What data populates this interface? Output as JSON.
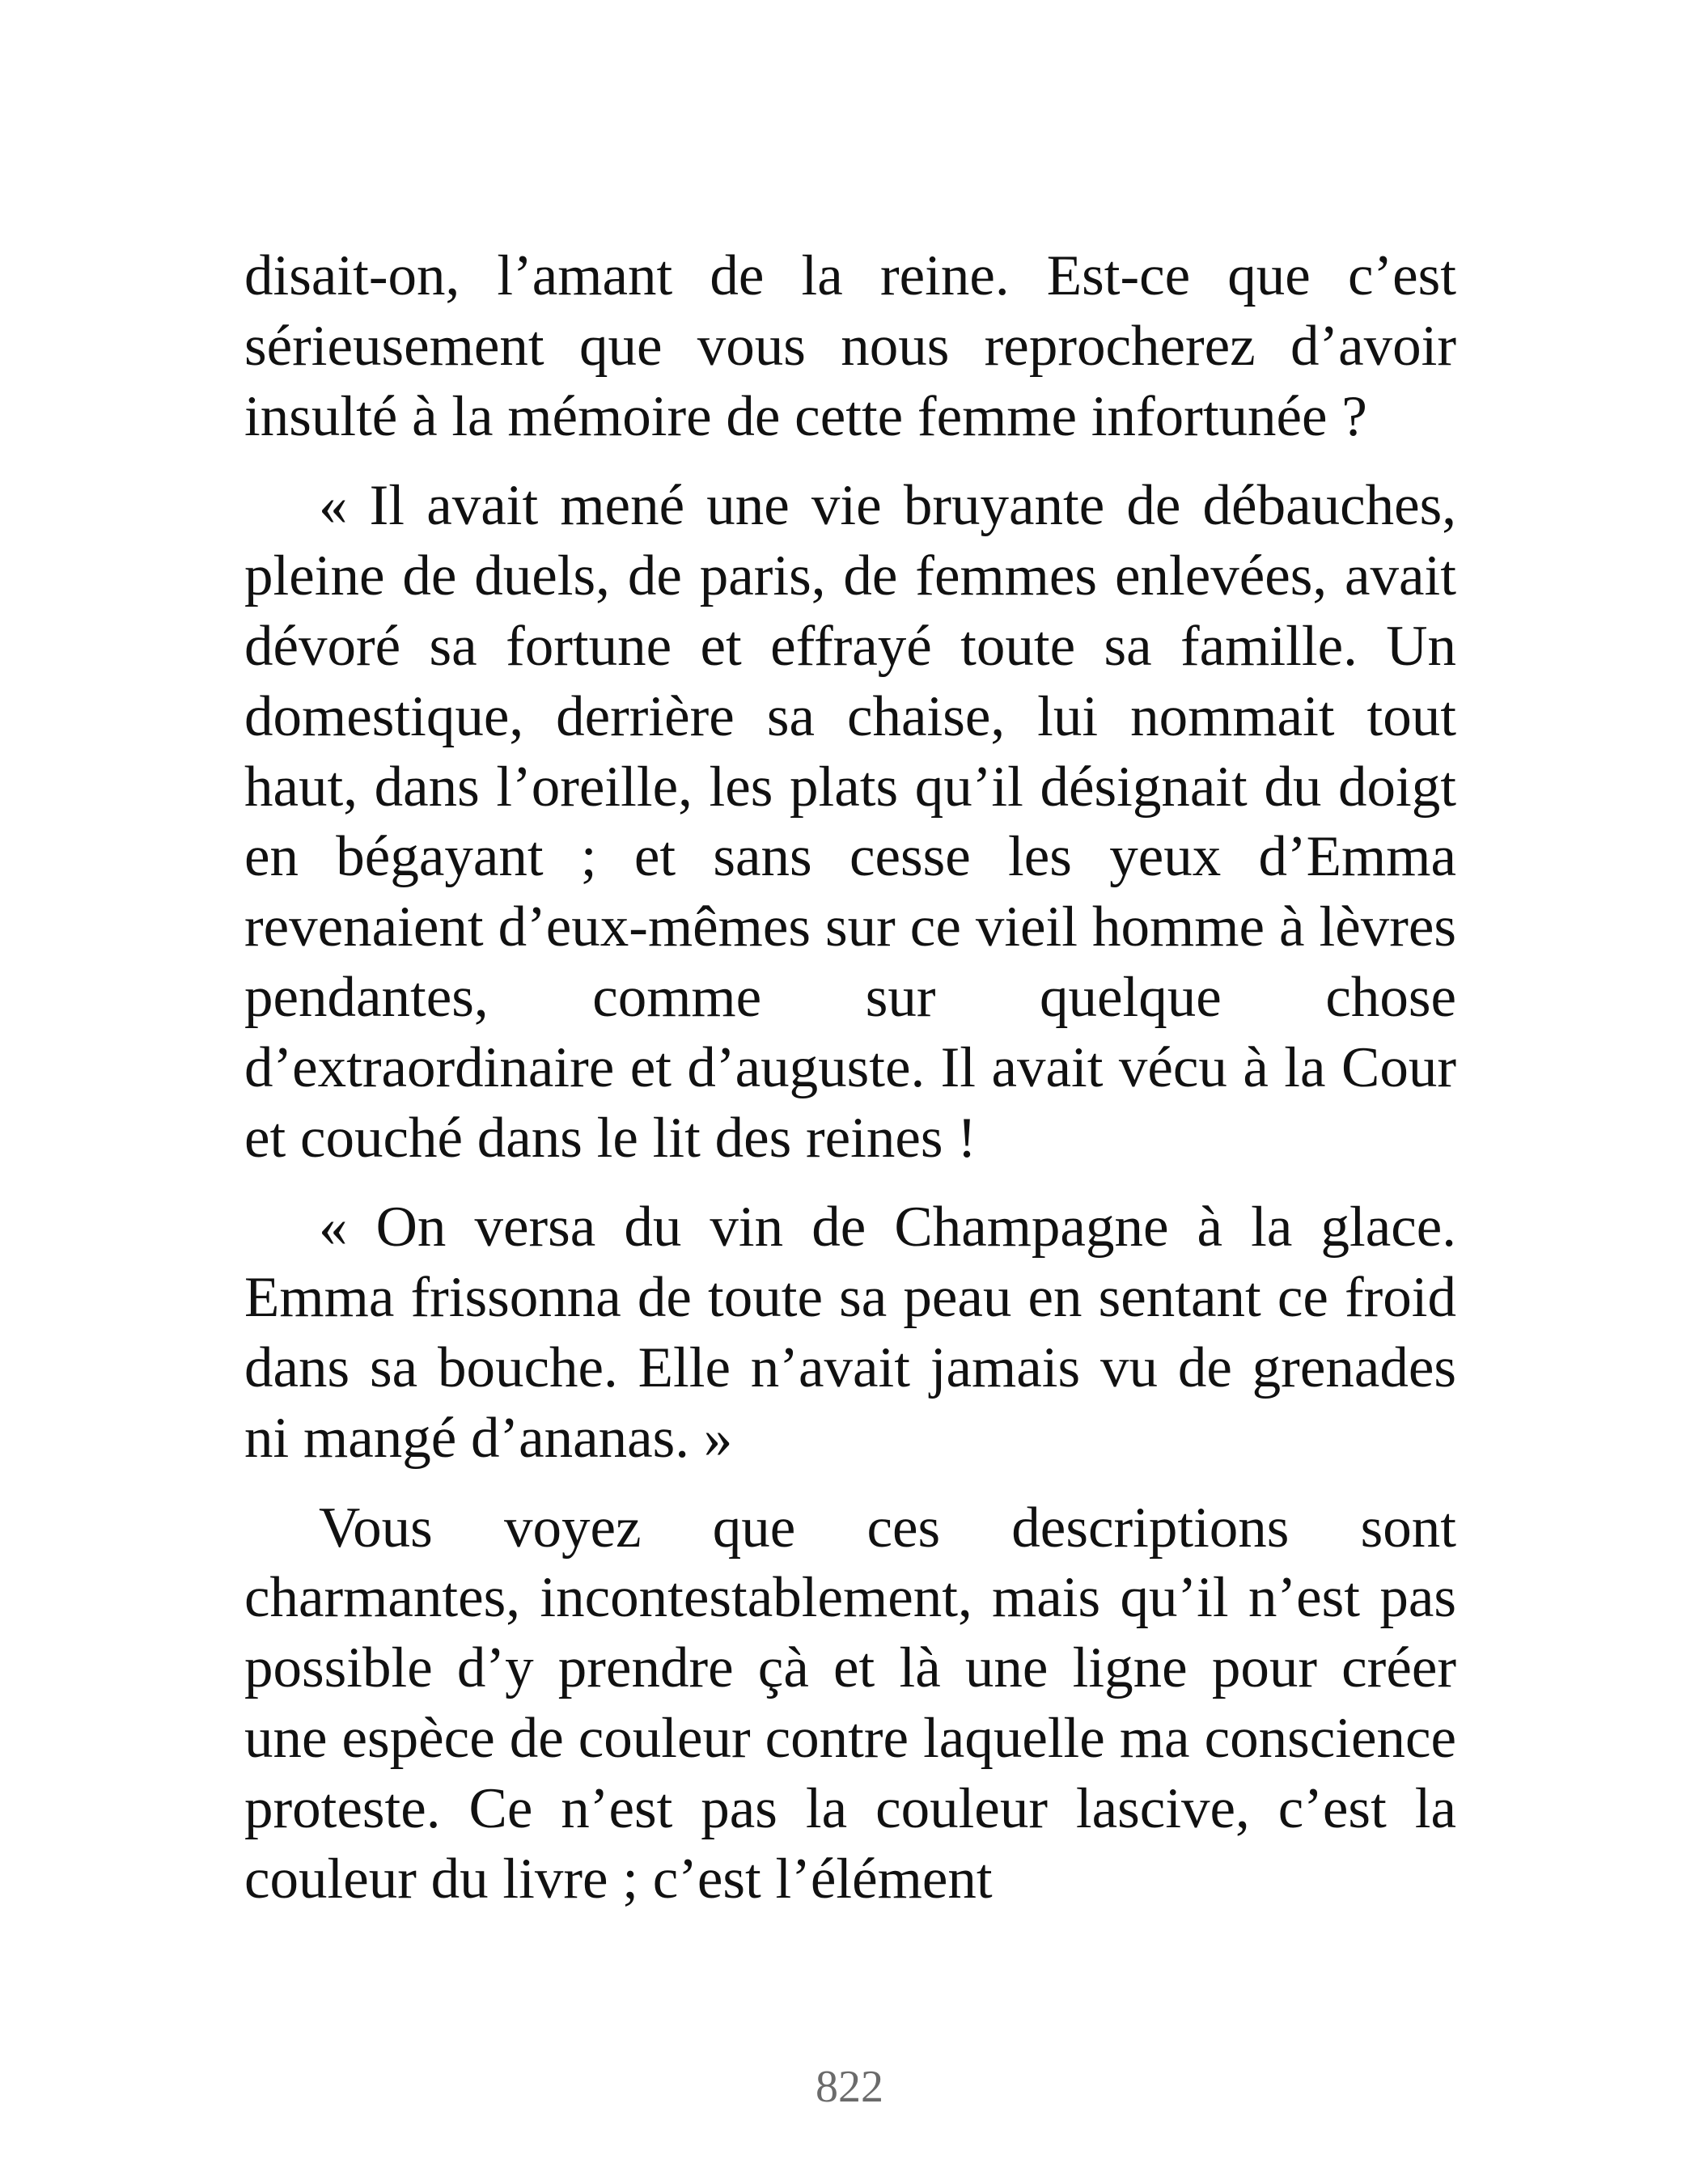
{
  "document": {
    "paragraphs": [
      "disait-on, l’amant de la reine. Est-ce que c’est sérieusement que vous nous reprocherez d’avoir insulté à la mémoire de cette femme infortunée ?",
      "« Il avait mené une vie bruyante de débauches, pleine de duels, de paris, de femmes enlevées, avait dévoré sa fortune et effrayé toute sa famille. Un domestique, derrière sa chaise, lui nommait tout haut, dans l’oreille, les plats qu’il désignait du doigt en bégayant ; et sans cesse les yeux d’Emma revenaient d’eux-mêmes sur ce vieil homme à lèvres pendantes, comme sur quelque chose d’extraordinaire et d’auguste. Il avait vécu à la Cour et couché dans le lit des reines !",
      "« On versa du vin de Champagne à la glace. Emma frissonna de toute sa peau en sentant ce froid dans sa bouche. Elle n’avait jamais vu de grenades ni mangé d’ananas. »",
      "Vous voyez que ces descriptions sont charmantes, incontestablement, mais qu’il n’est pas possible d’y prendre çà et là une ligne pour créer une espèce de couleur contre laquelle ma conscience proteste. Ce n’est pas la couleur lascive, c’est la couleur du livre ; c’est l’élément"
    ],
    "page_number": "822"
  }
}
